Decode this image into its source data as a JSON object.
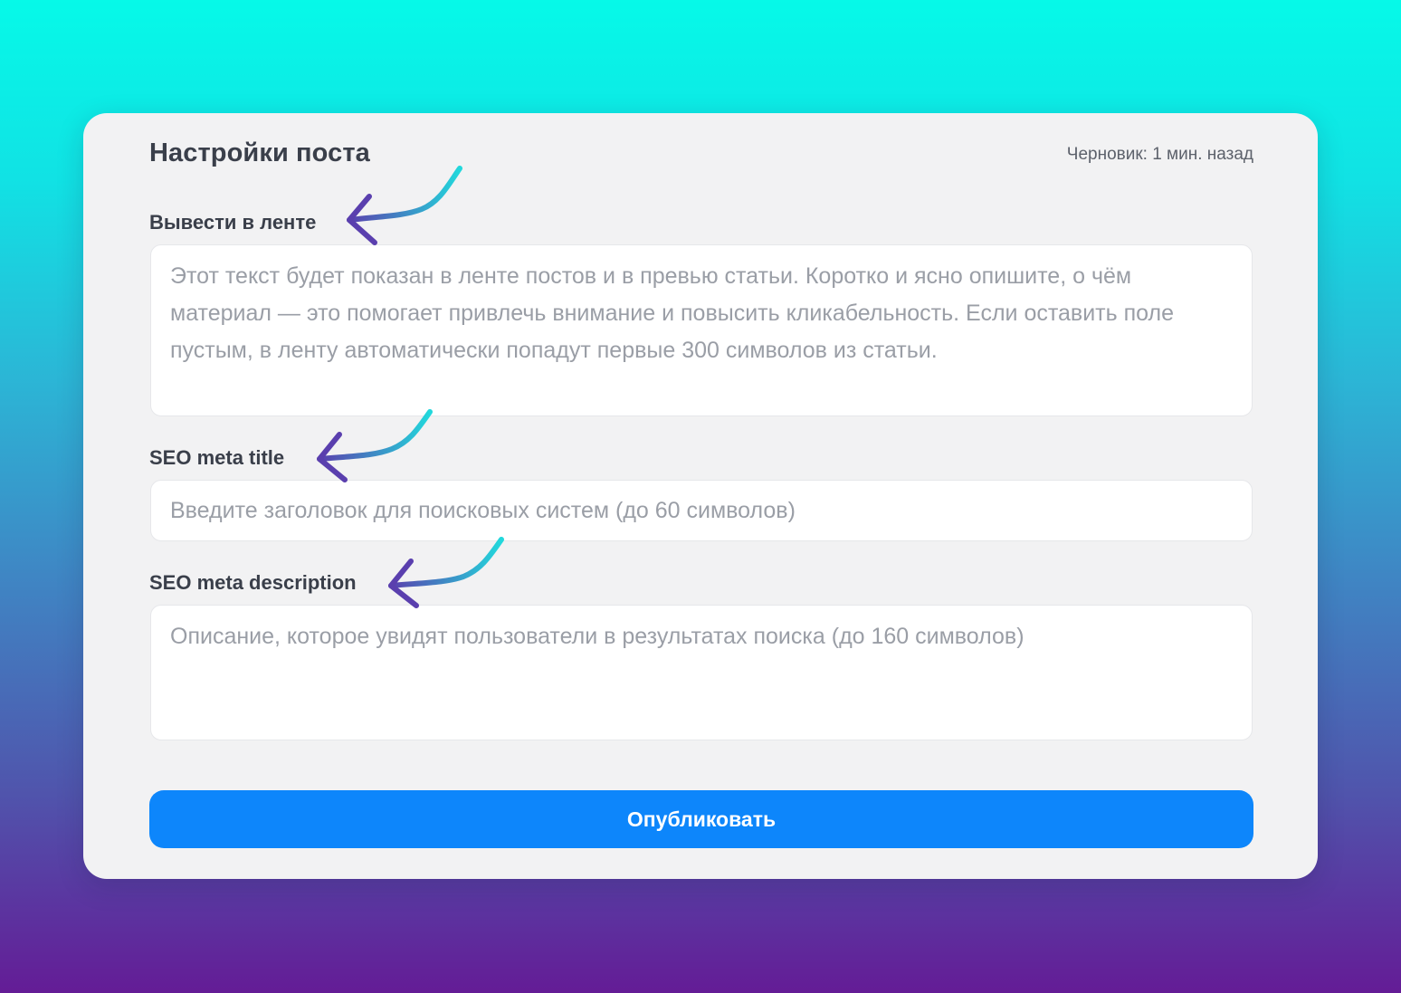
{
  "card": {
    "title": "Настройки поста",
    "draft_status": "Черновик: 1 мин. назад"
  },
  "feed": {
    "label": "Вывести в ленте",
    "placeholder": "Этот текст будет показан в ленте постов и в превью статьи. Коротко и ясно опишите, о чём материал — это помогает привлечь внимание и повысить кликабельность. Если оставить поле пустым, в ленту автоматически попадут первые 300 символов из статьи.",
    "value": ""
  },
  "seo_title": {
    "label": "SEO meta title",
    "placeholder": "Введите заголовок для поисковых систем (до 60 символов)",
    "value": ""
  },
  "seo_description": {
    "label": "SEO meta description",
    "placeholder": "Описание, которое увидят пользователи в результатах поиска (до 160 символов)",
    "value": ""
  },
  "actions": {
    "publish_label": "Опубликовать"
  },
  "colors": {
    "accent": "#0d86fb",
    "card_background": "#f2f2f3",
    "arrow_start": "#5a3fae",
    "arrow_end": "#22d8dc"
  },
  "annotations": {
    "arrow_icon": "curved-arrow-pointing-left"
  }
}
